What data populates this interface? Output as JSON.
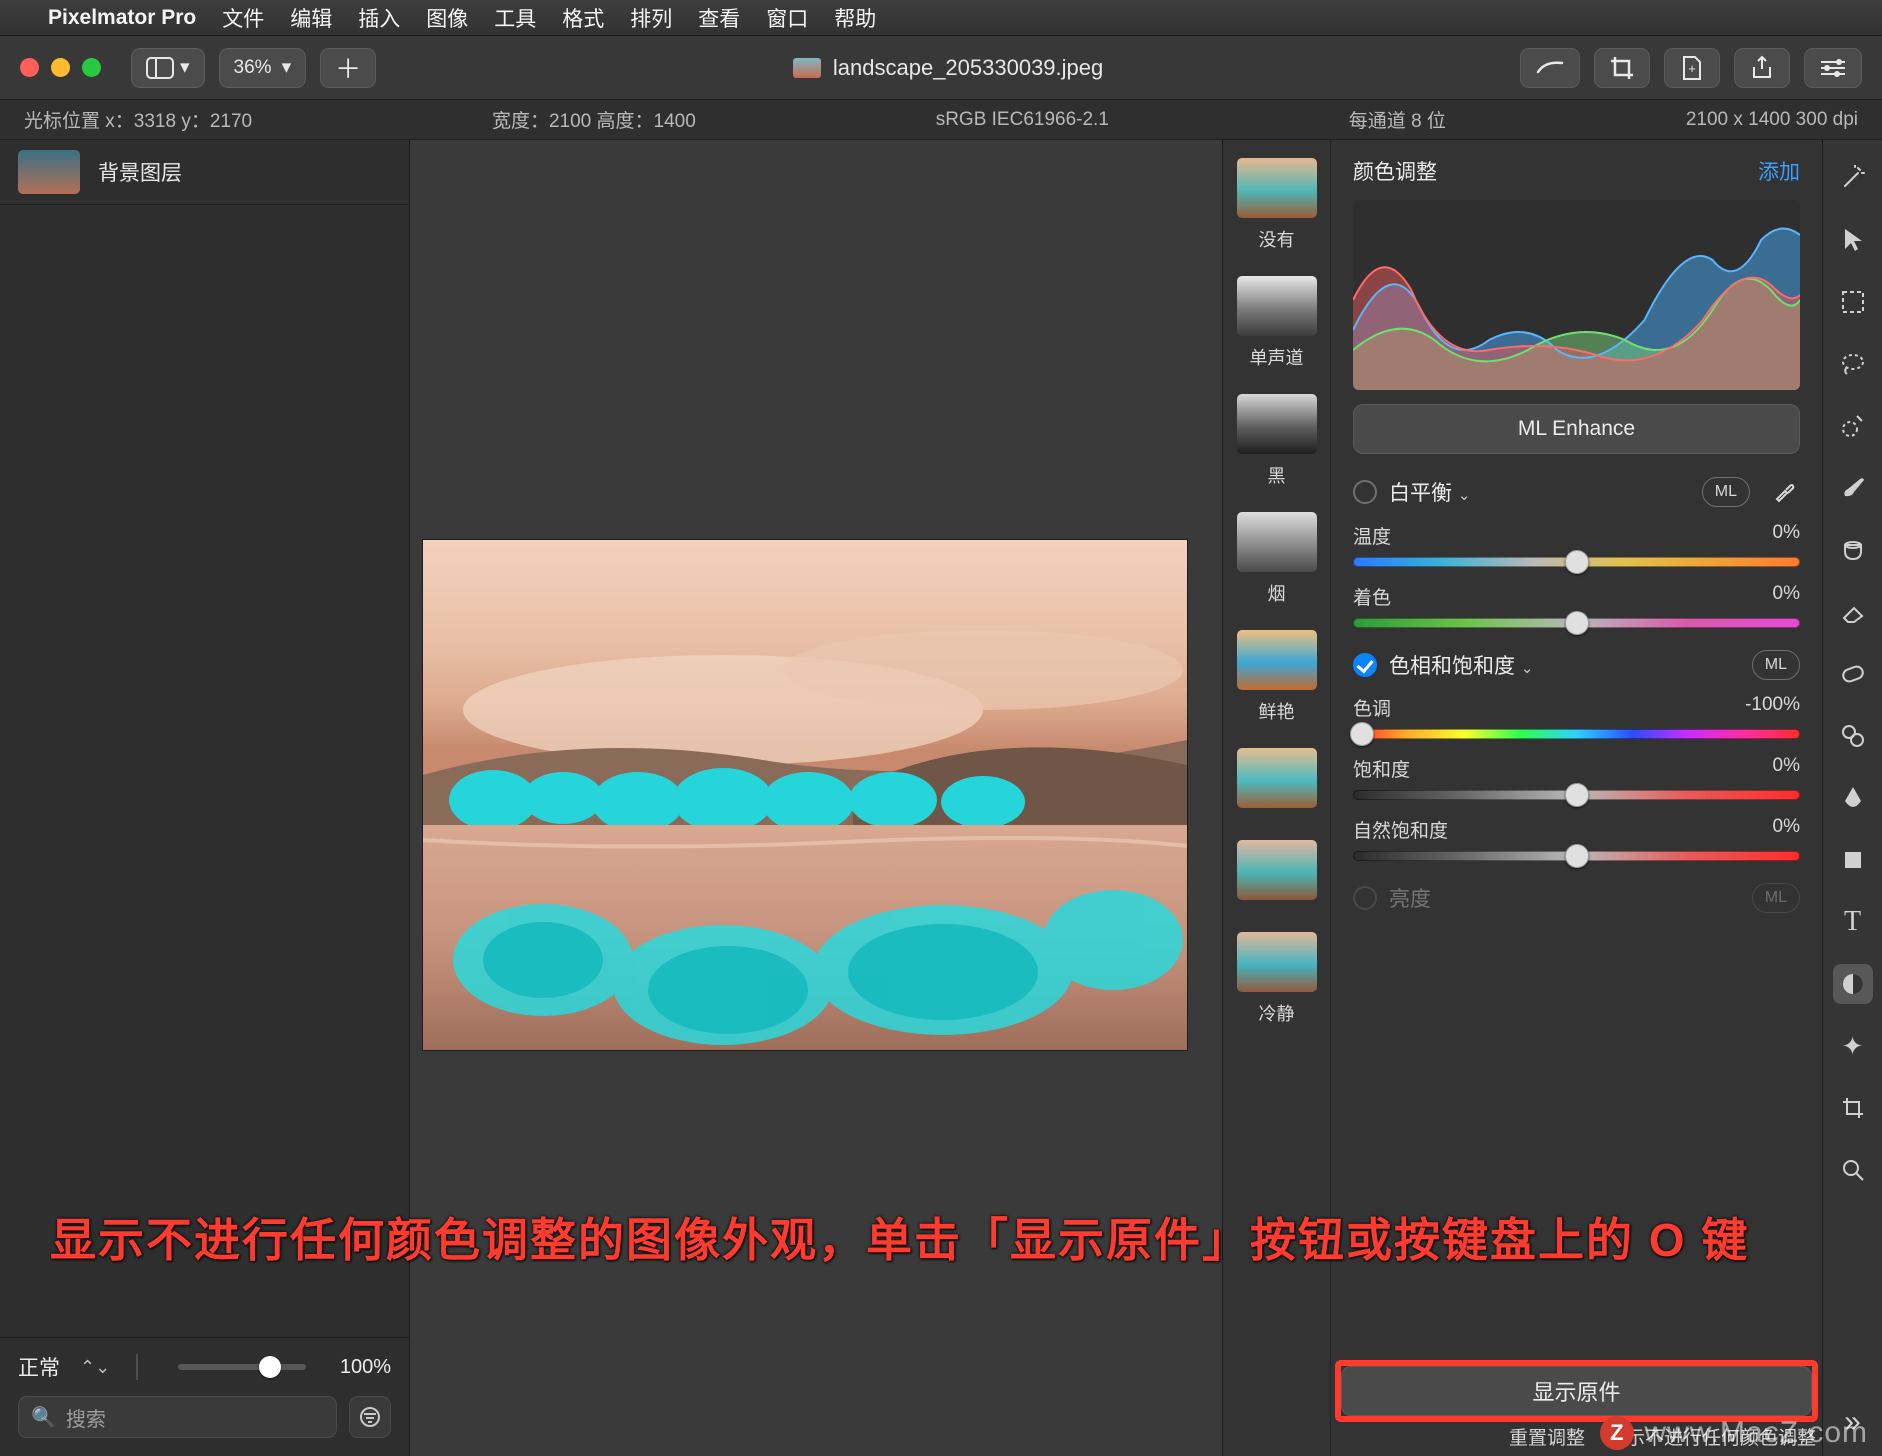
{
  "menubar": {
    "app": "Pixelmator Pro",
    "items": [
      "文件",
      "编辑",
      "插入",
      "图像",
      "工具",
      "格式",
      "排列",
      "查看",
      "窗口",
      "帮助"
    ]
  },
  "toolbar": {
    "zoom": "36%",
    "doc_title": "landscape_205330039.jpeg"
  },
  "infobar": {
    "cursor_label": "光标位置 x：3318    y：2170",
    "size_label": "宽度：2100    高度：1400",
    "profile": "sRGB IEC61966-2.1",
    "depth": "每通道 8 位",
    "dims": "2100 x 1400 300 dpi"
  },
  "layers": {
    "layer_name": "背景图层",
    "blend_mode": "正常",
    "opacity_label": "100%",
    "search_placeholder": "搜索"
  },
  "thumbs": [
    {
      "label": "没有",
      "bg": "linear-gradient(#e7b88e,#4fb8b7 55%,#9a5a35)"
    },
    {
      "label": "单声道",
      "bg": "linear-gradient(#e9e9e9,#7c7c7c 55%,#3b3b3b)"
    },
    {
      "label": "黑",
      "bg": "linear-gradient(#d9d9d9,#5e5e5e 55%,#1e1e1e)"
    },
    {
      "label": "烟",
      "bg": "linear-gradient(#dedede,#8b8b8b 55%,#4a4a4a)"
    },
    {
      "label": "鲜艳",
      "bg": "linear-gradient(#efc07e,#3aa7d6 55%,#c56a2e)"
    },
    {
      "label": "",
      "bg": "linear-gradient(#e6bd8f,#4dbac0 55%,#9d5c35)"
    },
    {
      "label": "",
      "bg": "linear-gradient(#e2b8a0,#49b4b5 55%,#8f5639)"
    },
    {
      "label": "冷静",
      "bg": "linear-gradient(#e2b897,#46b3c0 55%,#93593a)"
    }
  ],
  "adjust": {
    "title": "颜色调整",
    "add": "添加",
    "ml_enhance": "ML Enhance",
    "wb_title": "白平衡",
    "wb_temp": "温度",
    "wb_temp_val": "0%",
    "wb_tint": "着色",
    "wb_tint_val": "0%",
    "hs_title": "色相和饱和度",
    "hs_hue": "色调",
    "hs_hue_val": "-100%",
    "hs_sat": "饱和度",
    "hs_sat_val": "0%",
    "hs_vib": "自然饱和度",
    "hs_vib_val": "0%",
    "brightness": "亮度",
    "ml_label": "ML",
    "show_original": "显示原件",
    "reset": "重置调整",
    "reset_hint": "显示不进行任何颜色调整"
  },
  "annotation": "显示不进行任何颜色调整的图像外观，单击「显示原件」按钮或按键盘上的 O 键",
  "watermark": "www.MacZ.com"
}
